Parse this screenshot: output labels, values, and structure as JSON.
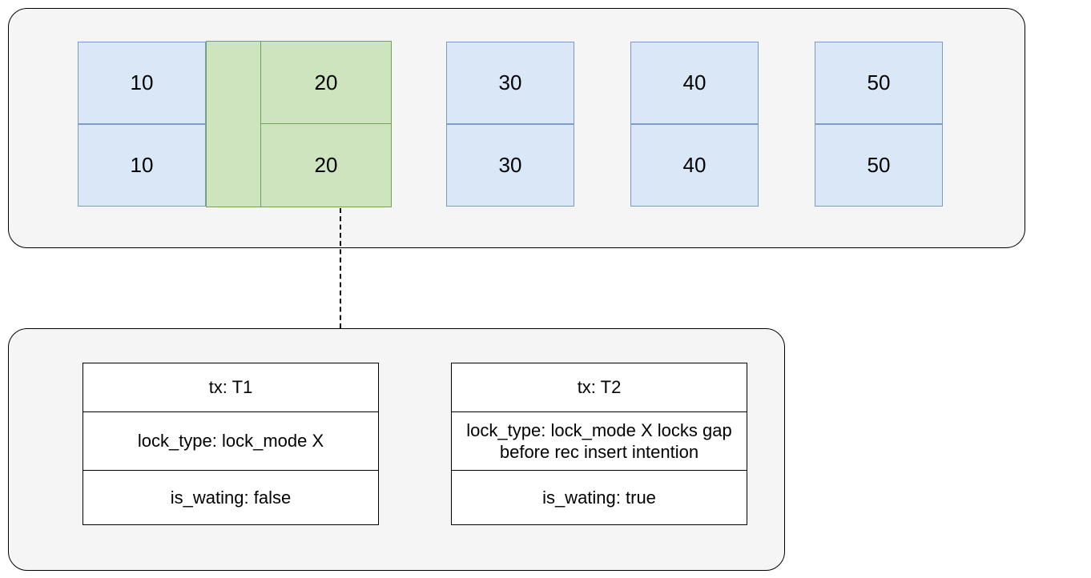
{
  "colors": {
    "record_fill": "#d9e7f7",
    "record_border": "#7a9cc6",
    "gap_fill": "#cde4bf",
    "gap_border": "#6fa35a",
    "panel_fill": "#f5f5f5"
  },
  "top_panel": {
    "records": [
      {
        "top": "10",
        "bottom": "10"
      },
      {
        "top": "20",
        "bottom": "20",
        "highlighted": true
      },
      {
        "top": "30",
        "bottom": "30"
      },
      {
        "top": "40",
        "bottom": "40"
      },
      {
        "top": "50",
        "bottom": "50"
      }
    ],
    "gap_before_index": 1
  },
  "connection": {
    "from": "record-20",
    "to": "lock-panel"
  },
  "lock_cards": [
    {
      "tx_label": "tx: T1",
      "lock_type_label": "lock_type: lock_mode X",
      "is_waiting_label": "is_wating: false"
    },
    {
      "tx_label": "tx: T2",
      "lock_type_label": "lock_type: lock_mode X locks gap before rec insert intention",
      "is_waiting_label": "is_wating: true"
    }
  ]
}
